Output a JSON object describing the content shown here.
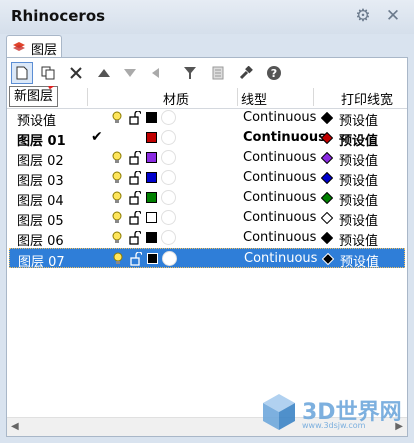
{
  "window": {
    "title": "Rhinoceros"
  },
  "tab": {
    "label": "图层"
  },
  "tooltip": {
    "text": "新图层"
  },
  "toolbar": {
    "buttons": [
      {
        "name": "new-layer-button",
        "icon": "new-document-icon"
      },
      {
        "name": "new-sublayer-button",
        "icon": "copy-icon"
      },
      {
        "name": "delete-layer-button",
        "icon": "delete-x-icon"
      },
      {
        "name": "move-up-button",
        "icon": "triangle-up-icon"
      },
      {
        "name": "move-down-button",
        "icon": "triangle-down-icon"
      },
      {
        "name": "move-parent-button",
        "icon": "arrow-left-icon"
      },
      {
        "name": "filter-button",
        "icon": "filter-icon"
      },
      {
        "name": "layer-states-button",
        "icon": "document-icon"
      },
      {
        "name": "tools-button",
        "icon": "wrench-icon"
      },
      {
        "name": "help-button",
        "icon": "help-icon"
      }
    ]
  },
  "columns": {
    "material": "材质",
    "linetype": "线型",
    "print_width": "打印线宽"
  },
  "layers": [
    {
      "name": "预设值",
      "bold": false,
      "current": false,
      "bulb": true,
      "lock": true,
      "color": "#000000",
      "linetype": "Continuous",
      "print_color": "#000000",
      "print_label": "预设值",
      "selected": false
    },
    {
      "name": "图层 01",
      "bold": true,
      "current": true,
      "bulb": false,
      "lock": false,
      "color": "#c00000",
      "linetype": "Continuous",
      "print_color": "#c00000",
      "print_label": "预设值",
      "selected": false
    },
    {
      "name": "图层 02",
      "bold": false,
      "current": false,
      "bulb": true,
      "lock": true,
      "color": "#8a2be2",
      "linetype": "Continuous",
      "print_color": "#8a2be2",
      "print_label": "预设值",
      "selected": false
    },
    {
      "name": "图层 03",
      "bold": false,
      "current": false,
      "bulb": true,
      "lock": true,
      "color": "#0000cc",
      "linetype": "Continuous",
      "print_color": "#0000cc",
      "print_label": "预设值",
      "selected": false
    },
    {
      "name": "图层 04",
      "bold": false,
      "current": false,
      "bulb": true,
      "lock": true,
      "color": "#008000",
      "linetype": "Continuous",
      "print_color": "#008000",
      "print_label": "预设值",
      "selected": false
    },
    {
      "name": "图层 05",
      "bold": false,
      "current": false,
      "bulb": true,
      "lock": true,
      "color": "#ffffff",
      "linetype": "Continuous",
      "print_color": "#ffffff",
      "print_label": "预设值",
      "selected": false
    },
    {
      "name": "图层 06",
      "bold": false,
      "current": false,
      "bulb": true,
      "lock": true,
      "color": "#000000",
      "linetype": "Continuous",
      "print_color": "#000000",
      "print_label": "预设值",
      "selected": false
    },
    {
      "name": "图层 07",
      "bold": false,
      "current": false,
      "bulb": true,
      "lock": true,
      "color": "#000000",
      "linetype": "Continuous",
      "print_color": "#000000",
      "print_label": "预设值",
      "selected": true
    }
  ],
  "checkmark": "✔",
  "watermark": {
    "text": "3D世界网",
    "url": "www.3dsjw.com"
  }
}
